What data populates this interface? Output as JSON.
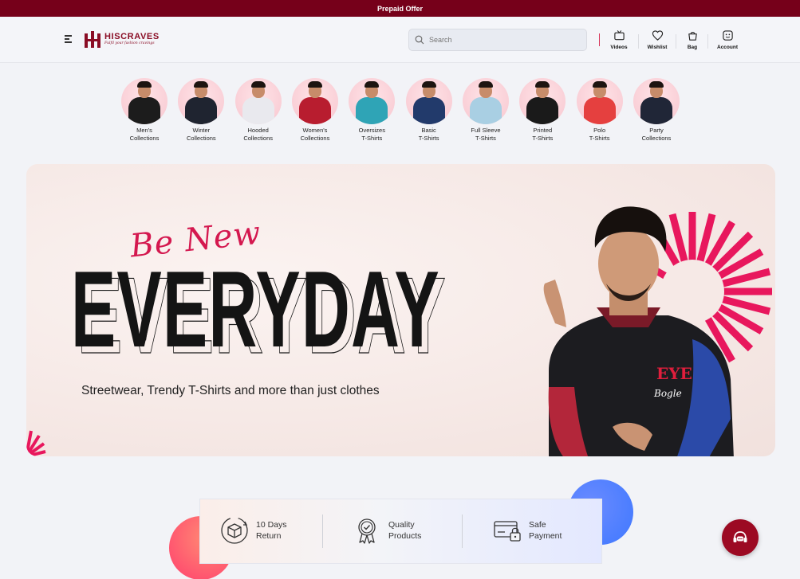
{
  "topbar": {
    "text": "Prepaid Offer"
  },
  "header": {
    "brand": "HISCRAVES",
    "tagline": "Fulfil your fashion cravings",
    "search_placeholder": "Search",
    "nav": [
      {
        "label": "Videos",
        "icon": "tv-icon"
      },
      {
        "label": "Wishlist",
        "icon": "heart-icon"
      },
      {
        "label": "Bag",
        "icon": "bag-icon"
      },
      {
        "label": "Account",
        "icon": "account-icon"
      }
    ]
  },
  "categories": [
    {
      "line1": "Men's",
      "line2": "Collections",
      "shirt": "#1c1c1c"
    },
    {
      "line1": "Winter",
      "line2": "Collections",
      "shirt": "#1f2430"
    },
    {
      "line1": "Hooded",
      "line2": "Collections",
      "shirt": "#e9e9ee"
    },
    {
      "line1": "Women's",
      "line2": "Collections",
      "shirt": "#b81d2f"
    },
    {
      "line1": "Oversizes",
      "line2": "T-Shirts",
      "shirt": "#2fa4b6"
    },
    {
      "line1": "Basic",
      "line2": "T-Shirts",
      "shirt": "#223a6b"
    },
    {
      "line1": "Full Sleeve",
      "line2": "T-Shirts",
      "shirt": "#a9cfe3"
    },
    {
      "line1": "Printed",
      "line2": "T-Shirts",
      "shirt": "#1a1a1a"
    },
    {
      "line1": "Polo",
      "line2": "T-Shirts",
      "shirt": "#e5403f"
    },
    {
      "line1": "Party",
      "line2": "Collections",
      "shirt": "#202637"
    }
  ],
  "banner": {
    "script": "Be New",
    "title": "EVERYDAY",
    "subtitle": "Streetwear, Trendy T-Shirts and more than just clothes",
    "print_main": "EYE",
    "print_script": "Bogle"
  },
  "features": [
    {
      "line1": "10 Days",
      "line2": "Return",
      "icon": "return-box-icon"
    },
    {
      "line1": "Quality",
      "line2": "Products",
      "icon": "quality-badge-icon"
    },
    {
      "line1": "Safe",
      "line2": "Payment",
      "icon": "secure-card-icon"
    }
  ],
  "colors": {
    "brand": "#76001a",
    "accent": "#d4184f"
  }
}
